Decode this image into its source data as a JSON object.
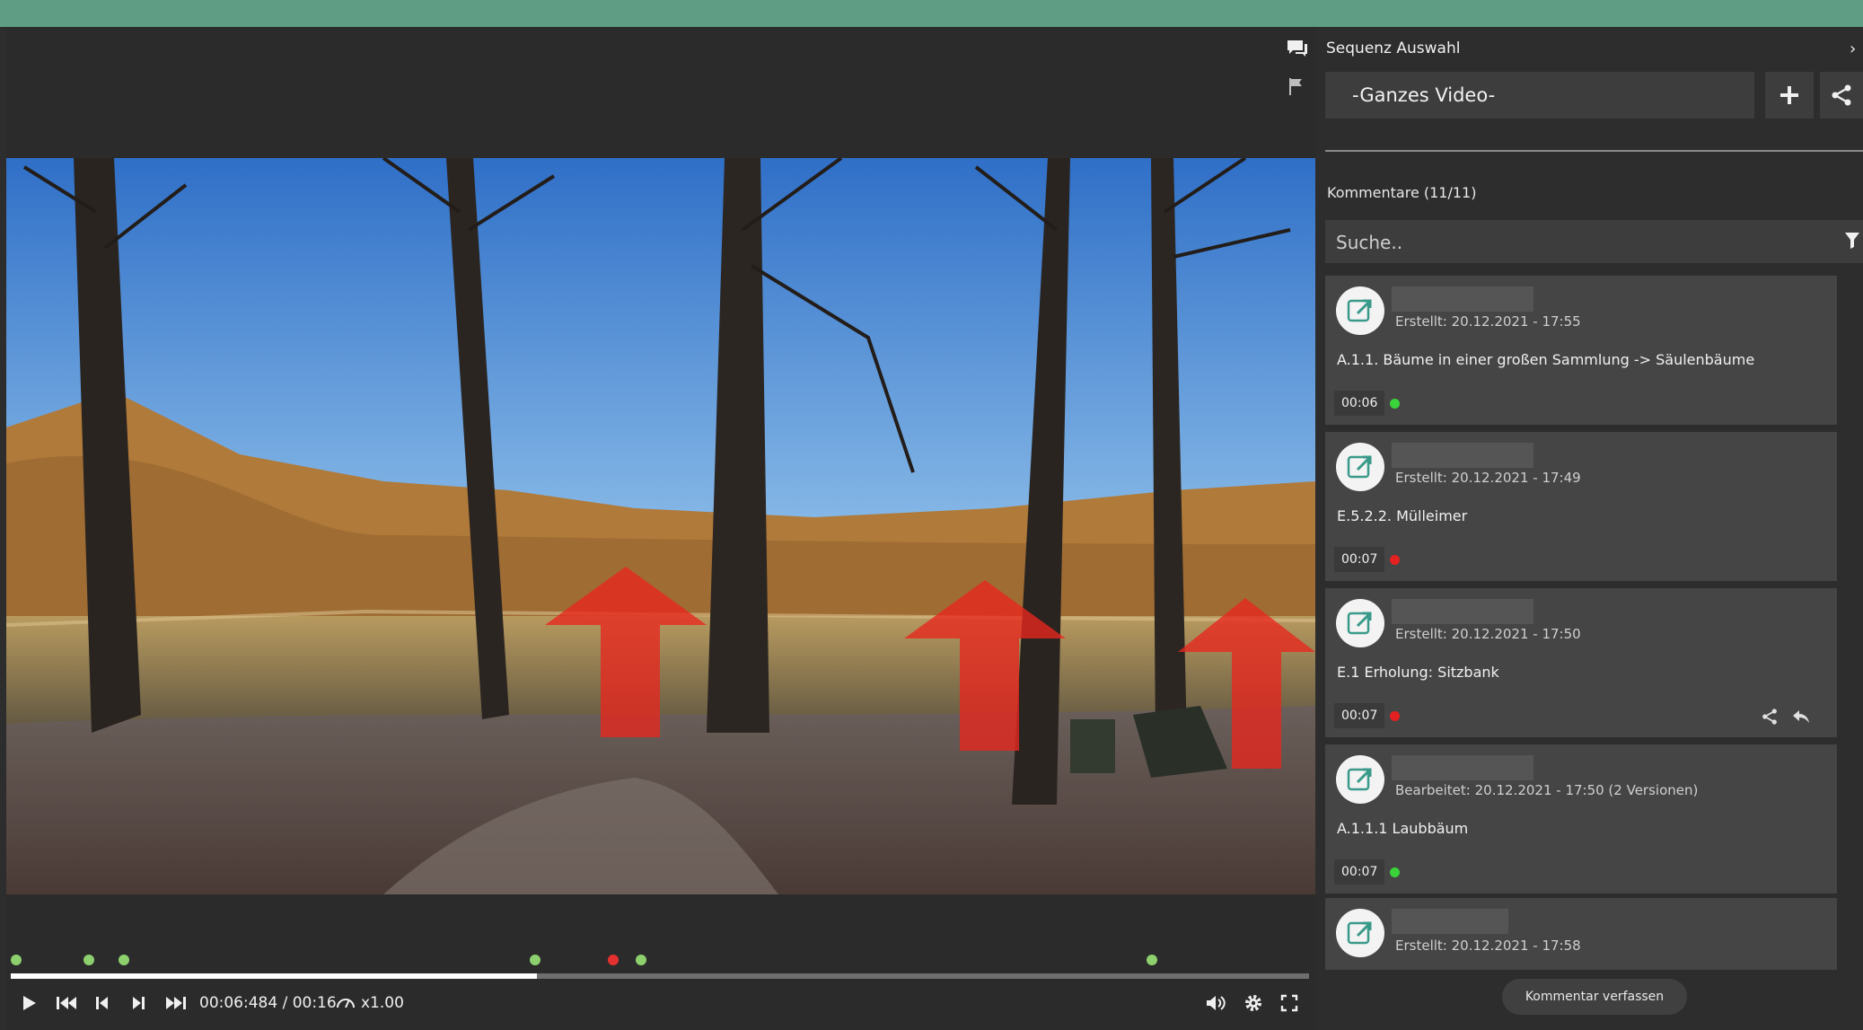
{
  "colors": {
    "topbar": "#5f9e85",
    "dot_green": "#3ad33a",
    "dot_red": "#e52020",
    "marker_green": "#8dd06e",
    "marker_red": "#e53030",
    "arrow": "#e8261e"
  },
  "player": {
    "time_display": "00:06:484 / 00:16",
    "speed_label": "x1.00",
    "progress": 0.405,
    "markers": [
      {
        "pos": 0.0,
        "status": "green"
      },
      {
        "pos": 0.056,
        "status": "green"
      },
      {
        "pos": 0.083,
        "status": "green"
      },
      {
        "pos": 0.4,
        "status": "green"
      },
      {
        "pos": 0.46,
        "status": "red"
      },
      {
        "pos": 0.481,
        "status": "green"
      },
      {
        "pos": 0.875,
        "status": "green"
      }
    ],
    "icons": [
      "play-icon",
      "skip-first-icon",
      "step-back-icon",
      "step-forward-icon",
      "skip-last-icon",
      "speed-icon",
      "volume-icon",
      "gear-icon",
      "fullscreen-icon"
    ]
  },
  "sidebar_icons": [
    "comments-icon",
    "flag-icon"
  ],
  "panel": {
    "sequence_label": "Sequenz Auswahl",
    "sequence_value": "-Ganzes Video-",
    "add_icon": "plus-icon",
    "share_icon": "share-icon",
    "comments_title": "Kommentare (11/11)",
    "search_placeholder": "Suche..",
    "filter_icon": "filter-icon",
    "compose_label": "Kommentar verfassen",
    "comments": [
      {
        "meta": "Erstellt: 20.12.2021 - 17:55",
        "text": "A.1.1. Bäume in einer großen Sammlung -> Säulenbäume",
        "timestamp": "00:06",
        "status": "green"
      },
      {
        "meta": "Erstellt: 20.12.2021 - 17:49",
        "text": "E.5.2.2. Mülleimer",
        "timestamp": "00:07",
        "status": "red"
      },
      {
        "meta": "Erstellt: 20.12.2021 - 17:50",
        "text": "E.1 Erholung: Sitzbank",
        "timestamp": "00:07",
        "status": "red"
      },
      {
        "meta": "Bearbeitet: 20.12.2021 - 17:50 (2 Versionen)",
        "text": "A.1.1.1 Laubbäum",
        "timestamp": "00:07",
        "status": "green"
      },
      {
        "meta": "Erstellt: 20.12.2021 - 17:58"
      }
    ]
  }
}
